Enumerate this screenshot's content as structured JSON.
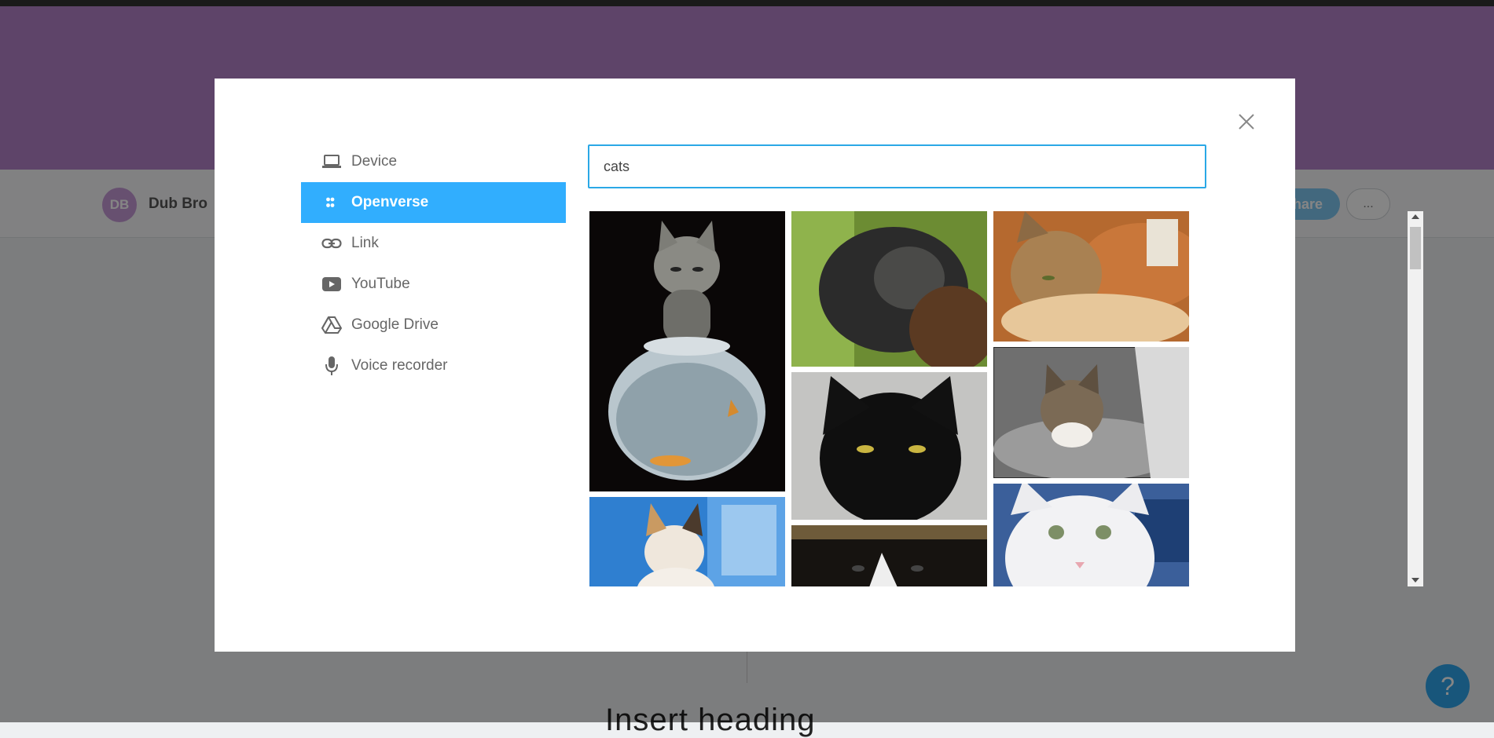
{
  "background": {
    "user": {
      "initials": "DB",
      "name": "Dub Bro"
    },
    "share_label": "Share",
    "more_label": "...",
    "heading": "Insert heading",
    "help_label": "?"
  },
  "modal": {
    "close_icon": "close-icon",
    "menu": [
      {
        "label": "Device",
        "icon": "laptop-icon"
      },
      {
        "label": "Openverse",
        "icon": "openverse-icon",
        "active": true
      },
      {
        "label": "Link",
        "icon": "link-icon"
      },
      {
        "label": "YouTube",
        "icon": "youtube-icon"
      },
      {
        "label": "Google Drive",
        "icon": "google-drive-icon"
      },
      {
        "label": "Voice recorder",
        "icon": "microphone-icon"
      }
    ],
    "search": {
      "value": "cats"
    },
    "results": [
      {
        "subject": "kitten above fishbowl with goldfish"
      },
      {
        "subject": "calico kitten by blue window"
      },
      {
        "subject": "cat with black fur in grass"
      },
      {
        "subject": "black cat with yellow eyes"
      },
      {
        "subject": "black and white cat"
      },
      {
        "subject": "tabby cat by flower pot"
      },
      {
        "subject": "tabby cat on knitted blanket"
      },
      {
        "subject": "white cat with blue eyes"
      }
    ]
  },
  "colors": {
    "accent": "#31aefe",
    "banner": "#b583c9",
    "input_border": "#2aa8e6"
  }
}
